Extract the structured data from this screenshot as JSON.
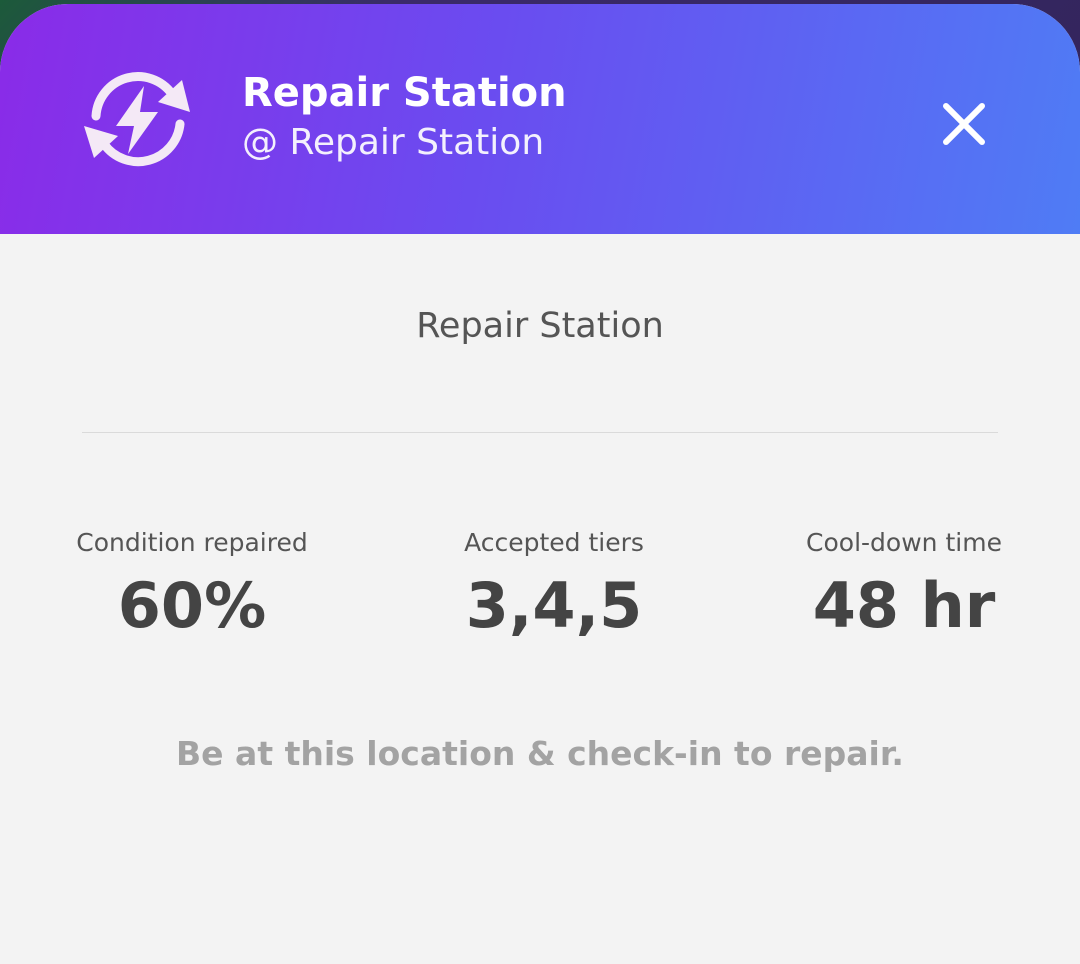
{
  "header": {
    "title": "Repair Station",
    "subtitle": "@ Repair Station",
    "icon": "repair-refresh-bolt-icon",
    "close_icon": "close-icon",
    "gradient_start": "#8a2be8",
    "gradient_end": "#4f7cf5"
  },
  "body": {
    "title": "Repair Station",
    "stats": [
      {
        "label": "Condition repaired",
        "value": "60%"
      },
      {
        "label": "Accepted tiers",
        "value": "3,4,5"
      },
      {
        "label": "Cool-down time",
        "value": "48 hr"
      }
    ],
    "note": "Be at this location & check-in to repair."
  }
}
